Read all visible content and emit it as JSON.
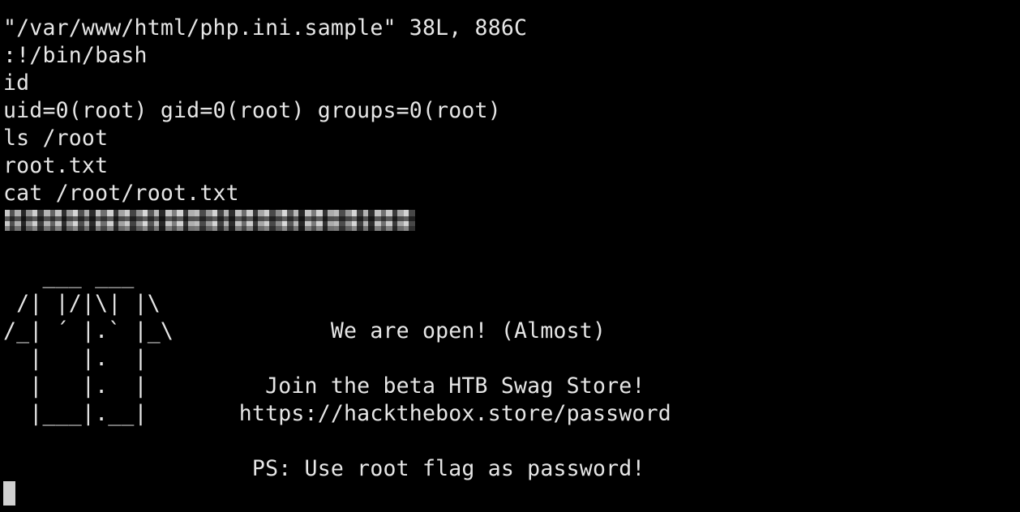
{
  "terminal": {
    "lines": [
      "\"/var/www/html/php.ini.sample\" 38L, 886C",
      ":!/bin/bash",
      "id",
      "uid=0(root) gid=0(root) groups=0(root)",
      "ls /root",
      "root.txt",
      "cat /root/root.txt"
    ],
    "banner": [
      "   ___ ___",
      " /| |/|\\| |\\",
      "/_| ´ |.` |_\\            We are open! (Almost)",
      "  |   |.  |",
      "  |   |.  |         Join the beta HTB Swag Store!",
      "  |___|.__|       https://hackthebox.store/password",
      "",
      "                   PS: Use root flag as password!"
    ]
  }
}
